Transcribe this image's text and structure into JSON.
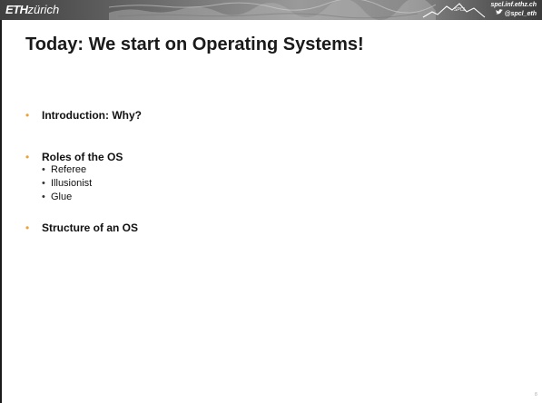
{
  "header": {
    "logo_eth": "ETH",
    "logo_zurich": "zürich",
    "url": "spcl.inf.ethz.ch",
    "twitter": "@spcl_eth",
    "mountain_caption": "SPCL"
  },
  "slide": {
    "title": "Today: We start on Operating Systems!",
    "bullets": [
      {
        "text": "Introduction: Why?",
        "subitems": []
      },
      {
        "text": "Roles of the OS",
        "subitems": [
          "Referee",
          "Illusionist",
          "Glue"
        ]
      },
      {
        "text": "Structure of an OS",
        "subitems": []
      }
    ],
    "page_number": "8"
  },
  "colors": {
    "bullet_accent": "#f0a030",
    "title": "#1a1a1a",
    "header_dark": "#3f3f3f"
  },
  "icons": [
    "twitter-bird-icon",
    "mountain-logo-icon"
  ]
}
